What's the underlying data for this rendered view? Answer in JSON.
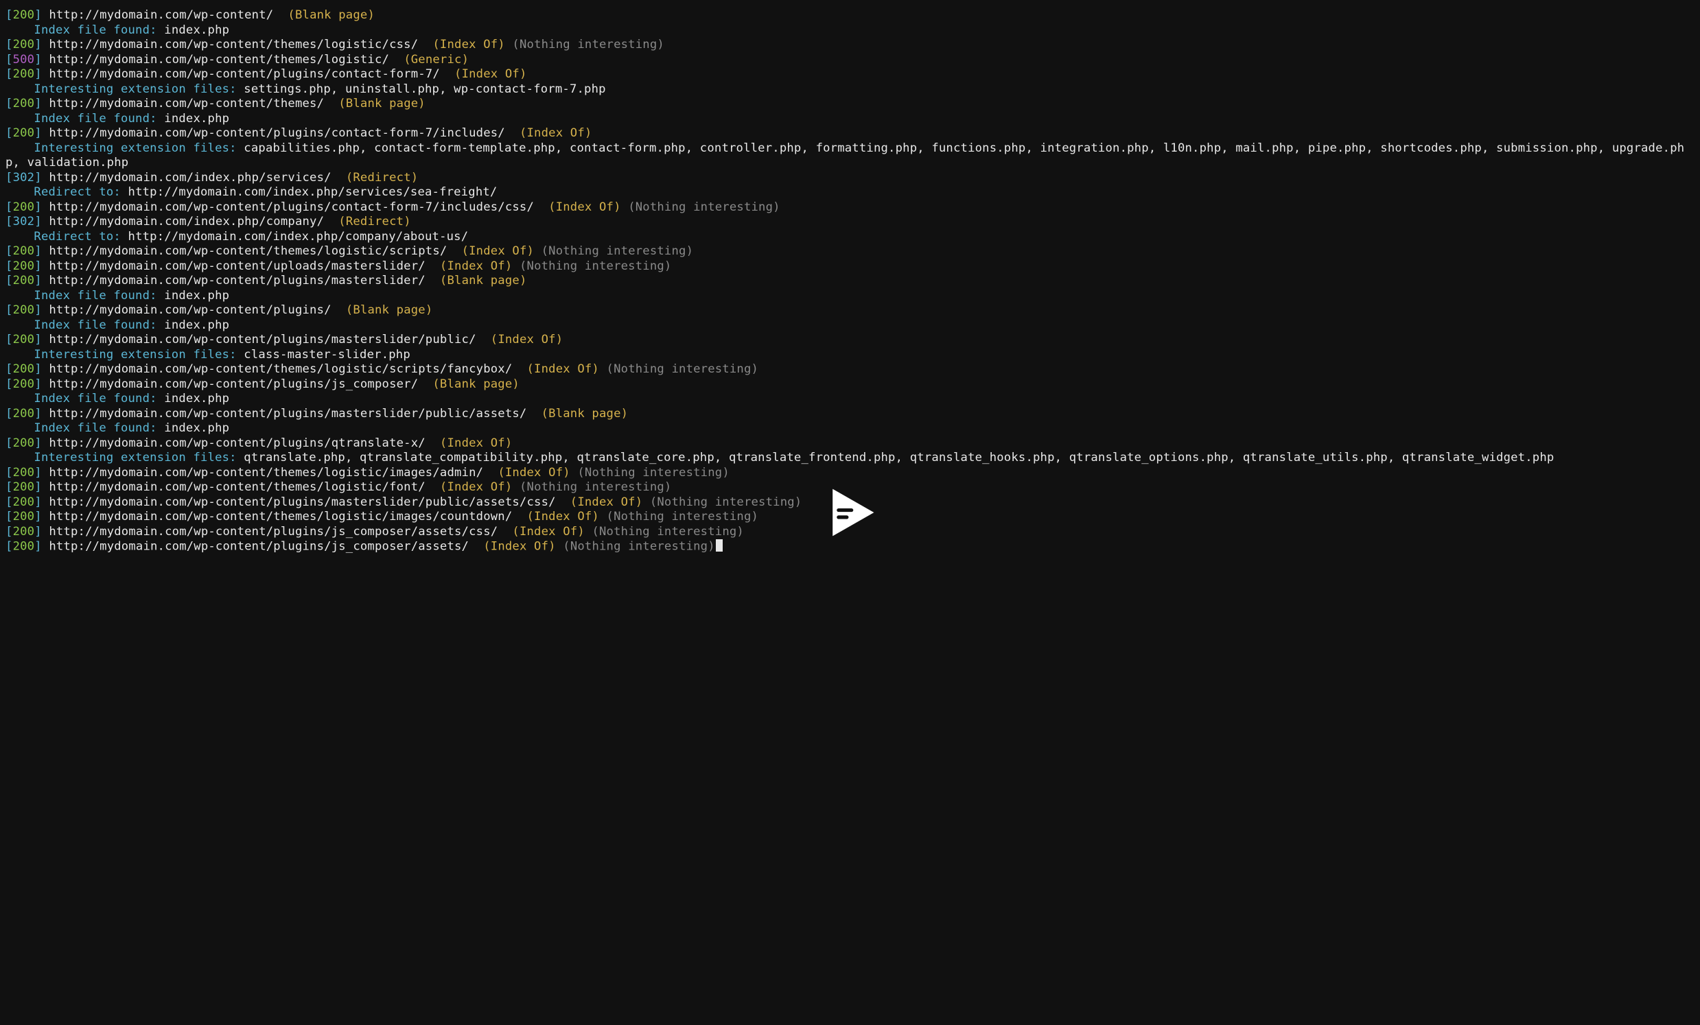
{
  "colors": {
    "code200": "#8cc84b",
    "code302": "#5bb7d6",
    "code500": "#b05fc4",
    "tagYellow": "#d6b24c",
    "tagGray": "#8a8a8a",
    "subLabel": "#5bb7d6",
    "background": "#111111",
    "foreground": "#e8e8e8"
  },
  "lines": [
    {
      "type": "entry",
      "code": "200",
      "url": "http://mydomain.com/wp-content/",
      "tags": [
        {
          "text": "(Blank page)",
          "style": "yellow"
        }
      ]
    },
    {
      "type": "sub",
      "label": "Index file found:",
      "value": "index.php"
    },
    {
      "type": "entry",
      "code": "200",
      "url": "http://mydomain.com/wp-content/themes/logistic/css/",
      "tags": [
        {
          "text": "(Index Of)",
          "style": "yellow"
        },
        {
          "text": "(Nothing interesting)",
          "style": "gray"
        }
      ]
    },
    {
      "type": "entry",
      "code": "500",
      "url": "http://mydomain.com/wp-content/themes/logistic/",
      "tags": [
        {
          "text": "(Generic)",
          "style": "yellow"
        }
      ]
    },
    {
      "type": "entry",
      "code": "200",
      "url": "http://mydomain.com/wp-content/plugins/contact-form-7/",
      "tags": [
        {
          "text": "(Index Of)",
          "style": "yellow"
        }
      ]
    },
    {
      "type": "sub",
      "label": "Interesting extension files:",
      "value": "settings.php, uninstall.php, wp-contact-form-7.php"
    },
    {
      "type": "entry",
      "code": "200",
      "url": "http://mydomain.com/wp-content/themes/",
      "tags": [
        {
          "text": "(Blank page)",
          "style": "yellow"
        }
      ]
    },
    {
      "type": "sub",
      "label": "Index file found:",
      "value": "index.php"
    },
    {
      "type": "entry",
      "code": "200",
      "url": "http://mydomain.com/wp-content/plugins/contact-form-7/includes/",
      "tags": [
        {
          "text": "(Index Of)",
          "style": "yellow"
        }
      ]
    },
    {
      "type": "sub",
      "label": "Interesting extension files:",
      "value": "capabilities.php, contact-form-template.php, contact-form.php, controller.php, formatting.php, functions.php, integration.php, l10n.php, mail.php, pipe.php, shortcodes.php, submission.php, upgrade.php, validation.php"
    },
    {
      "type": "entry",
      "code": "302",
      "url": "http://mydomain.com/index.php/services/",
      "tags": [
        {
          "text": "(Redirect)",
          "style": "yellow"
        }
      ]
    },
    {
      "type": "sub",
      "label": "Redirect to:",
      "value": "http://mydomain.com/index.php/services/sea-freight/"
    },
    {
      "type": "entry",
      "code": "200",
      "url": "http://mydomain.com/wp-content/plugins/contact-form-7/includes/css/",
      "tags": [
        {
          "text": "(Index Of)",
          "style": "yellow"
        },
        {
          "text": "(Nothing interesting)",
          "style": "gray"
        }
      ]
    },
    {
      "type": "entry",
      "code": "302",
      "url": "http://mydomain.com/index.php/company/",
      "tags": [
        {
          "text": "(Redirect)",
          "style": "yellow"
        }
      ]
    },
    {
      "type": "sub",
      "label": "Redirect to:",
      "value": "http://mydomain.com/index.php/company/about-us/"
    },
    {
      "type": "entry",
      "code": "200",
      "url": "http://mydomain.com/wp-content/themes/logistic/scripts/",
      "tags": [
        {
          "text": "(Index Of)",
          "style": "yellow"
        },
        {
          "text": "(Nothing interesting)",
          "style": "gray"
        }
      ]
    },
    {
      "type": "entry",
      "code": "200",
      "url": "http://mydomain.com/wp-content/uploads/masterslider/",
      "tags": [
        {
          "text": "(Index Of)",
          "style": "yellow"
        },
        {
          "text": "(Nothing interesting)",
          "style": "gray"
        }
      ]
    },
    {
      "type": "entry",
      "code": "200",
      "url": "http://mydomain.com/wp-content/plugins/masterslider/",
      "tags": [
        {
          "text": "(Blank page)",
          "style": "yellow"
        }
      ]
    },
    {
      "type": "sub",
      "label": "Index file found:",
      "value": "index.php"
    },
    {
      "type": "entry",
      "code": "200",
      "url": "http://mydomain.com/wp-content/plugins/",
      "tags": [
        {
          "text": "(Blank page)",
          "style": "yellow"
        }
      ]
    },
    {
      "type": "sub",
      "label": "Index file found:",
      "value": "index.php"
    },
    {
      "type": "entry",
      "code": "200",
      "url": "http://mydomain.com/wp-content/plugins/masterslider/public/",
      "tags": [
        {
          "text": "(Index Of)",
          "style": "yellow"
        }
      ]
    },
    {
      "type": "sub",
      "label": "Interesting extension files:",
      "value": "class-master-slider.php"
    },
    {
      "type": "entry",
      "code": "200",
      "url": "http://mydomain.com/wp-content/themes/logistic/scripts/fancybox/",
      "tags": [
        {
          "text": "(Index Of)",
          "style": "yellow"
        },
        {
          "text": "(Nothing interesting)",
          "style": "gray"
        }
      ]
    },
    {
      "type": "entry",
      "code": "200",
      "url": "http://mydomain.com/wp-content/plugins/js_composer/",
      "tags": [
        {
          "text": "(Blank page)",
          "style": "yellow"
        }
      ]
    },
    {
      "type": "sub",
      "label": "Index file found:",
      "value": "index.php"
    },
    {
      "type": "entry",
      "code": "200",
      "url": "http://mydomain.com/wp-content/plugins/masterslider/public/assets/",
      "tags": [
        {
          "text": "(Blank page)",
          "style": "yellow"
        }
      ]
    },
    {
      "type": "sub",
      "label": "Index file found:",
      "value": "index.php"
    },
    {
      "type": "entry",
      "code": "200",
      "url": "http://mydomain.com/wp-content/plugins/qtranslate-x/",
      "tags": [
        {
          "text": "(Index Of)",
          "style": "yellow"
        }
      ]
    },
    {
      "type": "sub",
      "label": "Interesting extension files:",
      "value": "qtranslate.php, qtranslate_compatibility.php, qtranslate_core.php, qtranslate_frontend.php, qtranslate_hooks.php, qtranslate_options.php, qtranslate_utils.php, qtranslate_widget.php"
    },
    {
      "type": "entry",
      "code": "200",
      "url": "http://mydomain.com/wp-content/themes/logistic/images/admin/",
      "tags": [
        {
          "text": "(Index Of)",
          "style": "yellow"
        },
        {
          "text": "(Nothing interesting)",
          "style": "gray"
        }
      ]
    },
    {
      "type": "entry",
      "code": "200",
      "url": "http://mydomain.com/wp-content/themes/logistic/font/",
      "tags": [
        {
          "text": "(Index Of)",
          "style": "yellow"
        },
        {
          "text": "(Nothing interesting)",
          "style": "gray"
        }
      ]
    },
    {
      "type": "entry",
      "code": "200",
      "url": "http://mydomain.com/wp-content/plugins/masterslider/public/assets/css/",
      "tags": [
        {
          "text": "(Index Of)",
          "style": "yellow"
        },
        {
          "text": "(Nothing interesting)",
          "style": "gray"
        }
      ]
    },
    {
      "type": "entry",
      "code": "200",
      "url": "http://mydomain.com/wp-content/themes/logistic/images/countdown/",
      "tags": [
        {
          "text": "(Index Of)",
          "style": "yellow"
        },
        {
          "text": "(Nothing interesting)",
          "style": "gray"
        }
      ]
    },
    {
      "type": "entry",
      "code": "200",
      "url": "http://mydomain.com/wp-content/plugins/js_composer/assets/css/",
      "tags": [
        {
          "text": "(Index Of)",
          "style": "yellow"
        },
        {
          "text": "(Nothing interesting)",
          "style": "gray"
        }
      ]
    },
    {
      "type": "entry",
      "code": "200",
      "url": "http://mydomain.com/wp-content/plugins/js_composer/assets/",
      "tags": [
        {
          "text": "(Index Of)",
          "style": "yellow"
        },
        {
          "text": "(Nothing interesting)",
          "style": "gray"
        }
      ],
      "cursor": true
    }
  ]
}
